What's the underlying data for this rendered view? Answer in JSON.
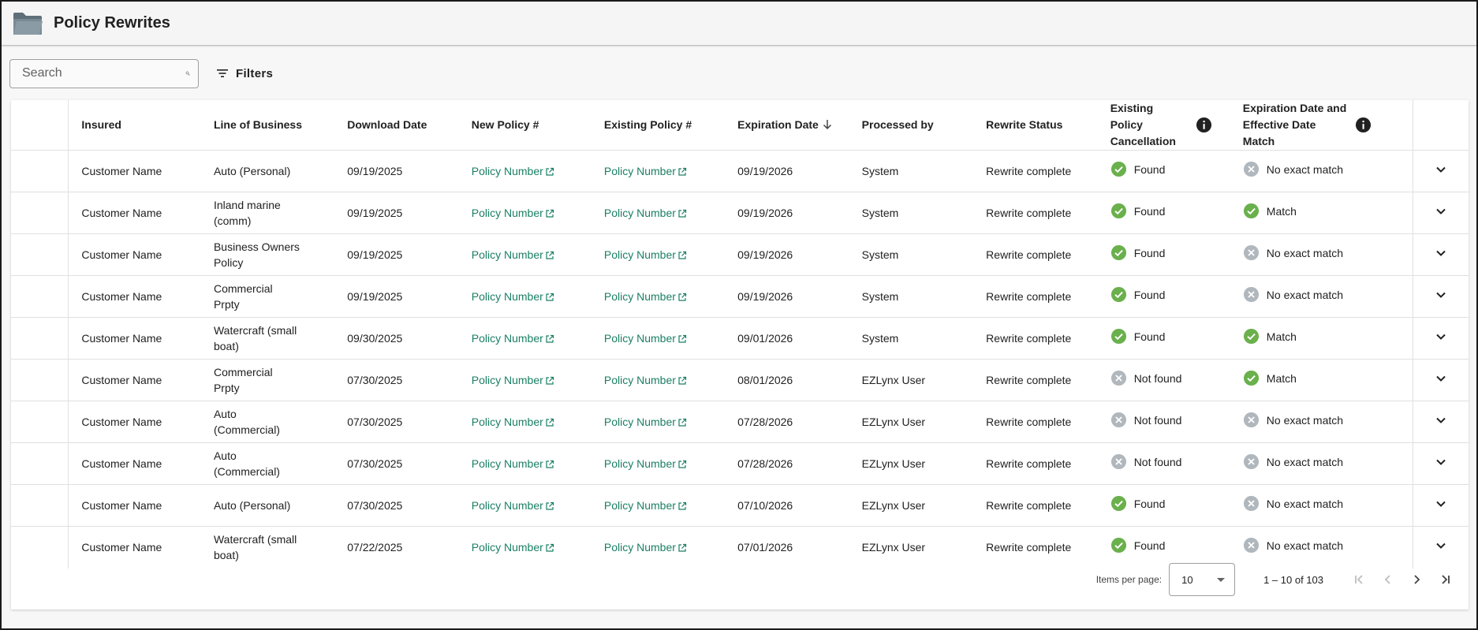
{
  "header": {
    "title": "Policy Rewrites",
    "icon": "folder-icon"
  },
  "search": {
    "placeholder": "Search"
  },
  "filters": {
    "label": "Filters"
  },
  "columns": {
    "insured": "Insured",
    "line_of_business": "Line of Business",
    "download_date": "Download Date",
    "new_policy": "New Policy #",
    "existing_policy": "Existing Policy #",
    "expiration_date": "Expiration Date",
    "processed_by": "Processed by",
    "rewrite_status": "Rewrite Status",
    "existing_policy_cancellation": "Existing Policy Cancellation",
    "date_match": "Expiration Date and Effective Date Match"
  },
  "colors": {
    "link": "#1a7f64",
    "success": "#6ab04c",
    "neutral": "#b0b7bd"
  },
  "rows": [
    {
      "insured": "Customer Name",
      "lob": "Auto (Personal)",
      "download": "09/19/2025",
      "new_policy": "Policy Number",
      "existing_policy": "Policy Number",
      "expiration": "09/19/2026",
      "processed_by": "System",
      "status": "Rewrite complete",
      "cancellation": "Found",
      "cancellation_ok": true,
      "match": "No exact match",
      "match_ok": false
    },
    {
      "insured": "Customer Name",
      "lob": "Inland marine (comm)",
      "download": "09/19/2025",
      "new_policy": "Policy Number",
      "existing_policy": "Policy Number",
      "expiration": "09/19/2026",
      "processed_by": "System",
      "status": "Rewrite complete",
      "cancellation": "Found",
      "cancellation_ok": true,
      "match": "Match",
      "match_ok": true
    },
    {
      "insured": "Customer Name",
      "lob": "Business Owners Policy",
      "download": "09/19/2025",
      "new_policy": "Policy Number",
      "existing_policy": "Policy Number",
      "expiration": "09/19/2026",
      "processed_by": "System",
      "status": "Rewrite complete",
      "cancellation": "Found",
      "cancellation_ok": true,
      "match": "No exact match",
      "match_ok": false
    },
    {
      "insured": "Customer Name",
      "lob": "Commercial Prpty",
      "download": "09/19/2025",
      "new_policy": "Policy Number",
      "existing_policy": "Policy Number",
      "expiration": "09/19/2026",
      "processed_by": "System",
      "status": "Rewrite complete",
      "cancellation": "Found",
      "cancellation_ok": true,
      "match": "No exact match",
      "match_ok": false
    },
    {
      "insured": "Customer Name",
      "lob": "Watercraft (small boat)",
      "download": "09/30/2025",
      "new_policy": "Policy Number",
      "existing_policy": "Policy Number",
      "expiration": "09/01/2026",
      "processed_by": "System",
      "status": "Rewrite complete",
      "cancellation": "Found",
      "cancellation_ok": true,
      "match": "Match",
      "match_ok": true
    },
    {
      "insured": "Customer Name",
      "lob": "Commercial Prpty",
      "download": "07/30/2025",
      "new_policy": "Policy Number",
      "existing_policy": "Policy Number",
      "expiration": "08/01/2026",
      "processed_by": "EZLynx User",
      "status": "Rewrite complete",
      "cancellation": "Not found",
      "cancellation_ok": false,
      "match": "Match",
      "match_ok": true
    },
    {
      "insured": "Customer Name",
      "lob": "Auto (Commercial)",
      "download": "07/30/2025",
      "new_policy": "Policy Number",
      "existing_policy": "Policy Number",
      "expiration": "07/28/2026",
      "processed_by": "EZLynx User",
      "status": "Rewrite complete",
      "cancellation": "Not found",
      "cancellation_ok": false,
      "match": "No exact match",
      "match_ok": false
    },
    {
      "insured": "Customer Name",
      "lob": "Auto (Commercial)",
      "download": "07/30/2025",
      "new_policy": "Policy Number",
      "existing_policy": "Policy Number",
      "expiration": "07/28/2026",
      "processed_by": "EZLynx User",
      "status": "Rewrite complete",
      "cancellation": "Not found",
      "cancellation_ok": false,
      "match": "No exact match",
      "match_ok": false
    },
    {
      "insured": "Customer Name",
      "lob": "Auto (Personal)",
      "download": "07/30/2025",
      "new_policy": "Policy Number",
      "existing_policy": "Policy Number",
      "expiration": "07/10/2026",
      "processed_by": "EZLynx User",
      "status": "Rewrite complete",
      "cancellation": "Found",
      "cancellation_ok": true,
      "match": "No exact match",
      "match_ok": false
    },
    {
      "insured": "Customer Name",
      "lob": "Watercraft (small boat)",
      "download": "07/22/2025",
      "new_policy": "Policy Number",
      "existing_policy": "Policy Number",
      "expiration": "07/01/2026",
      "processed_by": "EZLynx User",
      "status": "Rewrite complete",
      "cancellation": "Found",
      "cancellation_ok": true,
      "match": "No exact match",
      "match_ok": false
    }
  ],
  "paginator": {
    "items_per_page_label": "Items per page:",
    "page_size": "10",
    "range": "1 – 10 of 103"
  }
}
